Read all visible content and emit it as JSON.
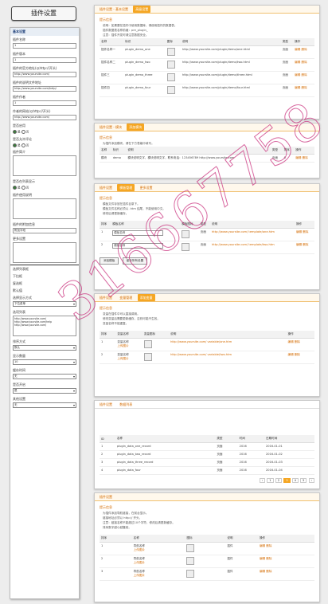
{
  "title": "插件设置",
  "sidebar": {
    "head": "基本设置",
    "fields": [
      {
        "label": "插件名称",
        "value": "1"
      },
      {
        "label": "插件版本",
        "value": "1"
      },
      {
        "label": "插件的官方地址(以http://开头)",
        "value": "http://www.yoursite.com/"
      },
      {
        "label": "插件的说明文件地址",
        "value": "http://www.yoursite.com/help/"
      },
      {
        "label": "插件作者",
        "value": "1"
      },
      {
        "label": "作者的网站(以http://开头)",
        "value": "http://www.yoursite.com/"
      }
    ],
    "radio1": {
      "label": "是否启用",
      "opt_yes": "是",
      "opt_no": "否"
    },
    "radio2": {
      "label": "是否允许评论",
      "opt_yes": "是",
      "opt_no": "否"
    },
    "desc_label": "插件简介",
    "radio3": {
      "label": "是否在列表显示",
      "opt_yes": "是",
      "opt_no": "否"
    },
    "text2_label": "插件使用说明",
    "extra_label": "插件的附加信息",
    "extra_field": "附加字段",
    "more_label": "更多设置",
    "dark_items": [
      "选择列表框",
      "下拉框",
      "复选框",
      "默认值"
    ],
    "select_label": "选择显示方式",
    "select1": "下拉菜单",
    "list_label": "选项列表",
    "list_text": "http://www.yoursite.com/ http://www.yoursite.com/help http://www.yoursite.com/",
    "select2_label": "排序方式",
    "select2": "默认",
    "select3_label": "显示数量",
    "select3": "10",
    "select4_label": "缓存时间",
    "select4": "无",
    "select5_label": "是否开启",
    "select5": "是",
    "select6_label": "其他设置",
    "select6": "无"
  },
  "panels": {
    "p1": {
      "tabs": [
        "插件设置 - 基本设置",
        "高级设置"
      ],
      "warn": "提示信息",
      "notes": [
        "说明：如果要在插件中使用数据库，请使用插件的数据表。",
        "插件数据表名称前缀：pre_plugin_",
        "注意：插件开发时请注意数据安全。"
      ],
      "headers": [
        "名称",
        "标识",
        "图标",
        "说明",
        "类型",
        "操作"
      ],
      "rows": [
        {
          "name": "插件名称一",
          "key": "plugin_demo_one",
          "desc": "http://www.yoursite.com/plugin/demo/one.html",
          "type": "页面",
          "op": "编辑 删除"
        },
        {
          "name": "插件名称二",
          "key": "plugin_demo_two",
          "desc": "http://www.yoursite.com/plugin/demo/two.html",
          "type": "页面",
          "op": "编辑 删除"
        },
        {
          "name": "插件三",
          "key": "plugin_demo_three",
          "desc": "http://www.yoursite.com/plugin/demo/three.html",
          "type": "页面",
          "op": "编辑 删除"
        },
        {
          "name": "插件四",
          "key": "plugin_demo_four",
          "desc": "http://www.yoursite.com/plugin/demo/four.html",
          "type": "页面",
          "op": "编辑 删除"
        }
      ]
    },
    "p2": {
      "tabs": [
        "插件设置 - 模块",
        "添加模块"
      ],
      "warn": "提示信息",
      "note": "为插件添加模块，请在下方表格中填写。",
      "headers": [
        "名称",
        "标识",
        "说明",
        "类型",
        "排序",
        "操作"
      ],
      "row": {
        "name": "模块",
        "key": "demo",
        "desc": "模块说明文字，模块说明文字，联系电话：123456789 http://www.yoursite.com",
        "type": "页面",
        "order": "0",
        "op": "编辑 删除"
      }
    },
    "p3": {
      "tabs": [
        "插件设置",
        "模板管理",
        "更多设置"
      ],
      "warn": "提示信息",
      "notes": [
        "模板文件存放在插件目录下。",
        "模板文件名称必须以 .htm 结尾，不能使用中文。",
        "修改后请更新缓存。"
      ],
      "headers": [
        "排序",
        "模板名称",
        "模板图标",
        "类型",
        "说明",
        "操作"
      ],
      "rows": [
        {
          "order": "1",
          "name": "模板名称",
          "type": "页面",
          "desc": "http://www.yoursite.com/ template/one.htm",
          "op": "编辑 删除"
        },
        {
          "order": "2",
          "name": "模板名称",
          "type": "页面",
          "desc": "http://www.yoursite.com/ template/two.htm",
          "op": "编辑 删除"
        }
      ],
      "btn_add": "添加模板",
      "btn_save": "保存所有设置"
    },
    "p4": {
      "tabs": [
        "插件设置",
        "变量管理",
        "添加变量"
      ],
      "warn": "提示信息",
      "notes": [
        "变量在插件中可以直接调用。",
        "修改变量后需要更新缓存，否则可能不生效。",
        "变量名称不能重复。"
      ],
      "headers": [
        "排序",
        "变量名称",
        "变量图标",
        "说明",
        "操作"
      ],
      "rows": [
        {
          "order": "1",
          "name": "变量名称",
          "upload": "上传图片",
          "desc": "http://www.yoursite.com/ variable/one.htm",
          "op": "编辑 删除"
        },
        {
          "order": "2",
          "name": "变量名称",
          "upload": "上传图片",
          "desc": "http://www.yoursite.com/ variable/two.htm",
          "op": "编辑 删除"
        }
      ]
    },
    "p5": {
      "tabs": [
        "插件设置",
        "数据列表"
      ],
      "headers": [
        "ID",
        "名称",
        "类型",
        "时间",
        "日期时间"
      ],
      "rows": [
        {
          "id": "1",
          "name": "plugin_data_one_record",
          "type": "页面",
          "time": "2016",
          "date": "2016-01-01"
        },
        {
          "id": "2",
          "name": "plugin_data_two_record",
          "type": "页面",
          "time": "2016",
          "date": "2016-01-02"
        },
        {
          "id": "3",
          "name": "plugin_data_three_record",
          "type": "页面",
          "time": "2016",
          "date": "2016-01-03"
        },
        {
          "id": "4",
          "name": "plugin_data_four",
          "type": "页面",
          "time": "2016",
          "date": "2016-01-04"
        }
      ],
      "pager": [
        "‹",
        "1",
        "2",
        "3",
        "4",
        "5",
        "›"
      ]
    },
    "p6": {
      "tabs": [
        "插件设置"
      ],
      "warn": "提示信息",
      "notes": [
        "为插件添加导航链接，在前台显示。",
        "链接地址必须以 http:// 开头。",
        "注意：链接名称不能超过10个字符，修改后请更新缓存。",
        "排序数字越小越靠前。"
      ],
      "headers": [
        "排序",
        "名称",
        "图标",
        "说明",
        "操作"
      ],
      "rows": [
        {
          "order": "1",
          "name": "导航名称",
          "upload": "上传图片",
          "desc": "插件",
          "op": "编辑 删除"
        },
        {
          "order": "2",
          "name": "导航名称",
          "upload": "上传图片",
          "desc": "插件",
          "op": "编辑 删除"
        },
        {
          "order": "3",
          "name": "导航名称",
          "upload": "上传图片",
          "desc": "插件",
          "op": "编辑 删除"
        }
      ]
    }
  },
  "watermark": "316667758",
  "colors": {
    "accent": "#f5a623",
    "link": "#d46b00",
    "watermark": "#c82878"
  }
}
